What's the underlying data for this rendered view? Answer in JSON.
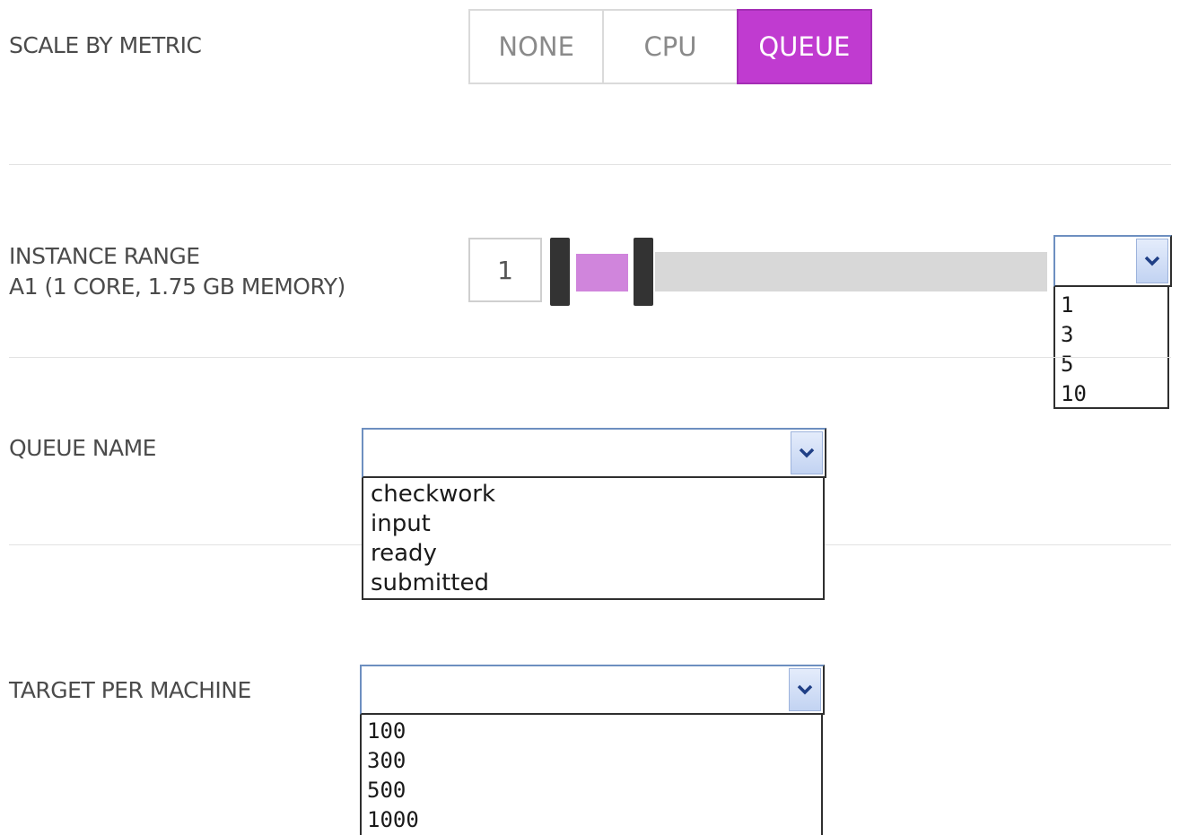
{
  "scale_by_metric": {
    "label": "SCALE BY METRIC",
    "options": [
      "NONE",
      "CPU",
      "QUEUE"
    ],
    "selected": "QUEUE",
    "active_color": "#c03bd0"
  },
  "instance_range": {
    "label": "INSTANCE RANGE",
    "sublabel": "A1 (1 CORE, 1.75 GB MEMORY)",
    "min_value": "1",
    "max_dropdown": {
      "selected": "",
      "options": [
        "1",
        "3",
        "5",
        "10"
      ]
    },
    "slider_fill_color": "#d085dc"
  },
  "queue_name": {
    "label": "QUEUE NAME",
    "selected": "",
    "options": [
      "checkwork",
      "input",
      "ready",
      "submitted"
    ]
  },
  "target_per_machine": {
    "label": "TARGET PER MACHINE",
    "selected": "",
    "options": [
      "100",
      "300",
      "500",
      "1000"
    ]
  },
  "icons": {
    "dropdown_arrow": "chevron-down-icon"
  }
}
